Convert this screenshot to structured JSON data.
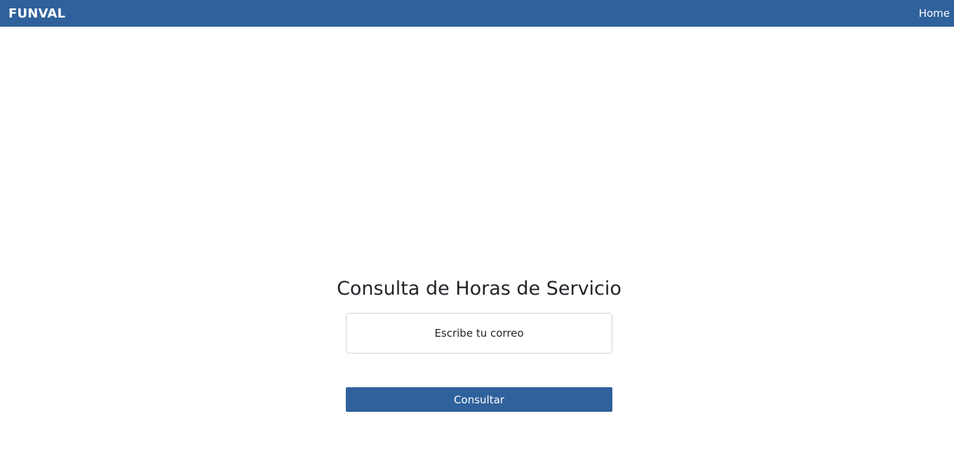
{
  "navbar": {
    "brand": "FUNVAL",
    "home_link": "Home"
  },
  "main": {
    "title": "Consulta de Horas de Servicio",
    "email_placeholder": "Escribe tu correo",
    "email_value": "",
    "submit_label": "Consultar"
  },
  "colors": {
    "primary": "#2f619c",
    "background": "#ffffff",
    "text": "#212529",
    "input_border": "#ced4da"
  }
}
